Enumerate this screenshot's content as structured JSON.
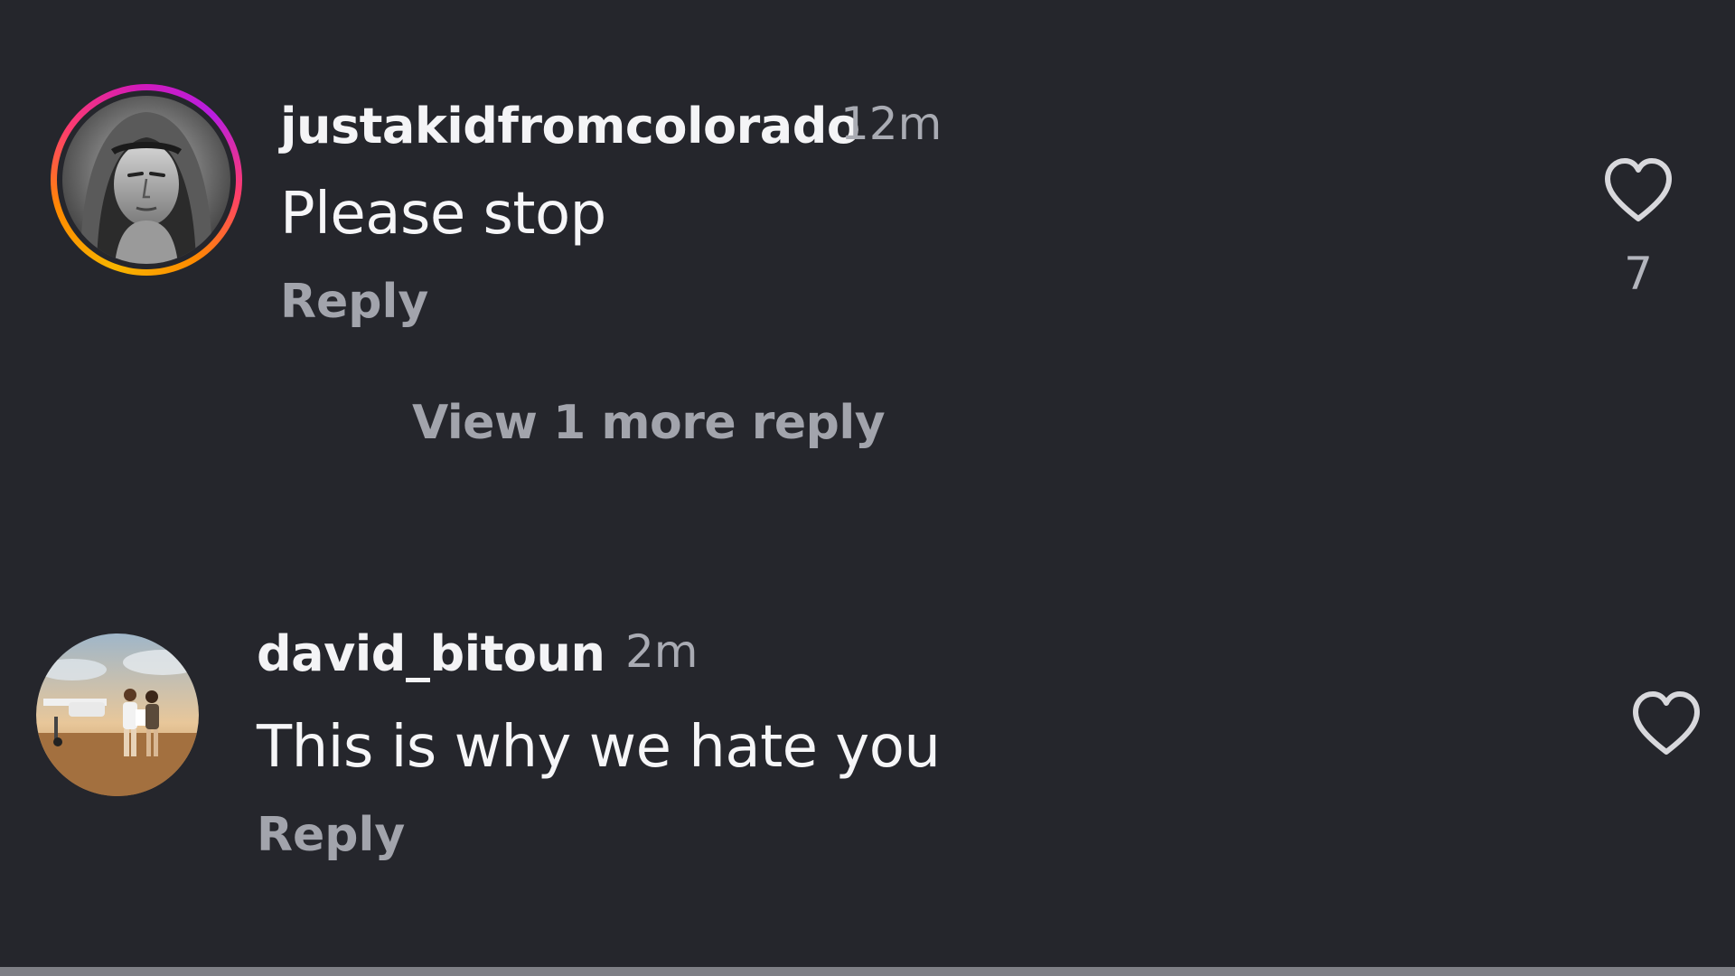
{
  "comments": [
    {
      "username": "justakidfromcolorado",
      "time": "12m",
      "text": "Please stop",
      "reply_label": "Reply",
      "like_count": "7",
      "has_story_ring": true,
      "view_more_label": "View 1 more reply",
      "avatar_icon": "hooded-man-portrait",
      "like_icon": "heart-outline-icon"
    },
    {
      "username": "david_bitoun",
      "time": "2m",
      "text": "This is why we hate you",
      "reply_label": "Reply",
      "has_story_ring": false,
      "avatar_icon": "couple-with-airplane-photo",
      "like_icon": "heart-outline-icon"
    }
  ],
  "colors": {
    "background": "#25262c",
    "primary_text": "#f4f4f6",
    "secondary_text": "#a2a4ac",
    "story_ring": [
      "#f7b500",
      "#ff3c6e",
      "#d21ab8"
    ]
  }
}
